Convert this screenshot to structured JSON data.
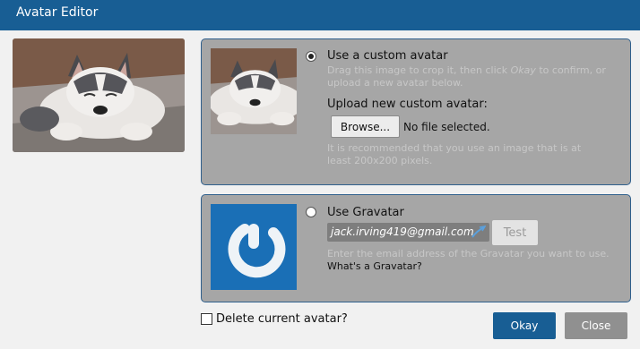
{
  "window": {
    "title": "Avatar Editor"
  },
  "custom_avatar": {
    "option_label": "Use a custom avatar",
    "selected": true,
    "hint_before": "Drag this image to crop it, then click ",
    "hint_action": "Okay",
    "hint_after": " to confirm, or upload a new avatar below.",
    "upload_label": "Upload new custom avatar:",
    "browse_label": "Browse...",
    "file_status": "No file selected.",
    "size_hint": "It is recommended that you use an image that is at least 200x200 pixels."
  },
  "gravatar": {
    "option_label": "Use Gravatar",
    "selected": false,
    "email_value": "jack.irving419@gmail.com",
    "test_label": "Test",
    "email_hint": "Enter the email address of the Gravatar you want to use.",
    "info_link": "What's a Gravatar?"
  },
  "footer": {
    "delete_label": "Delete current avatar?",
    "okay_label": "Okay",
    "close_label": "Close"
  },
  "colors": {
    "titlebar": "#185e94",
    "panel": "#a6a6a6",
    "panel_border": "#2f5f8c",
    "gravatar_blue": "#1a6fb6"
  },
  "icons": [
    "dog-photo",
    "gravatar-logo-icon",
    "gravatar-arrow-icon"
  ]
}
